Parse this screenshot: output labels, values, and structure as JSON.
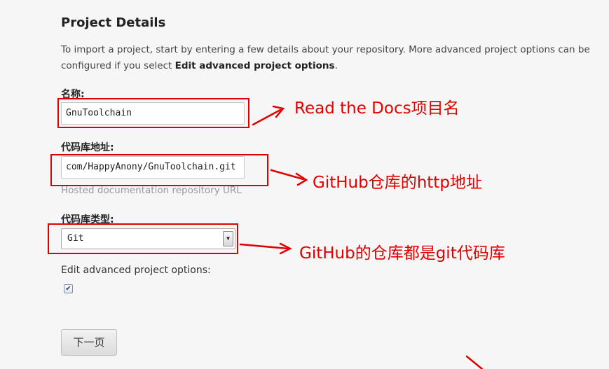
{
  "form": {
    "title": "Project Details",
    "intro_text": "To import a project, start by entering a few details about your repository. More advanced project options can be configured if you select ",
    "intro_bold": "Edit advanced project options",
    "intro_end": ".",
    "name_label": "名称:",
    "name_value": "GnuToolchain",
    "repo_label": "代码库地址:",
    "repo_value": "com/HappyAnony/GnuToolchain.git",
    "repo_help": "Hosted documentation repository URL",
    "type_label": "代码库类型:",
    "type_selected": "Git",
    "advanced_label": "Edit advanced project options:",
    "advanced_checked": true,
    "next_button": "下一页"
  },
  "annotations": {
    "name_note": "Read the Docs项目名",
    "repo_note": "GitHub仓库的http地址",
    "type_note": "GitHub的仓库都是git代码库",
    "color": "#e00000"
  },
  "icons": {
    "select_arrow": "chevron-down-icon",
    "checkbox_mark": "checkmark-icon"
  }
}
